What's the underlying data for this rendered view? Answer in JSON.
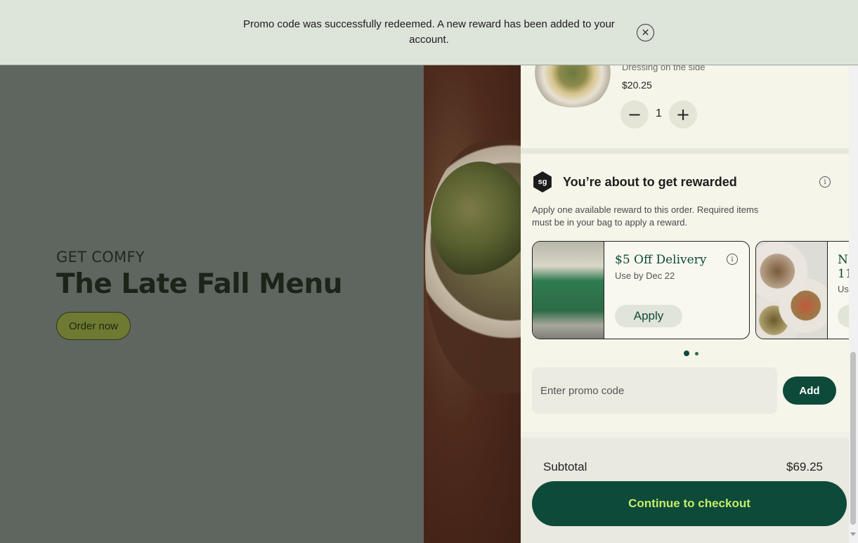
{
  "banner": {
    "message": "Promo code was successfully redeemed. A new reward has been added to your account.",
    "close_icon": "close-icon"
  },
  "hero": {
    "eyebrow": "GET COMFY",
    "headline": "The Late Fall Menu",
    "cta_label": "Order now"
  },
  "cart": {
    "item": {
      "option": "Dressing on the side",
      "price": "$20.25",
      "quantity": "1"
    },
    "rewards": {
      "logo_text": "sg",
      "title": "You’re about to get rewarded",
      "description": "Apply one available reward to this order. Required items must be in your bag to apply a reward.",
      "cards": [
        {
          "title": "$5 Off Delivery",
          "expiry": "Use by Dec 22",
          "apply_label": "Apply"
        },
        {
          "title_partial": "N\n11",
          "expiry_partial": "Us"
        }
      ],
      "pagination": {
        "current": 1,
        "total": 2
      }
    },
    "promo": {
      "placeholder": "Enter promo code",
      "add_label": "Add"
    },
    "summary": {
      "subtotal_label": "Subtotal",
      "subtotal_value": "$69.25",
      "checkout_label": "Continue to checkout"
    }
  },
  "colors": {
    "brand_green": "#0e4a3a",
    "checkout_text": "#c5ec6a",
    "banner_bg": "#dde4da",
    "panel_bg": "#f5f5ea"
  }
}
